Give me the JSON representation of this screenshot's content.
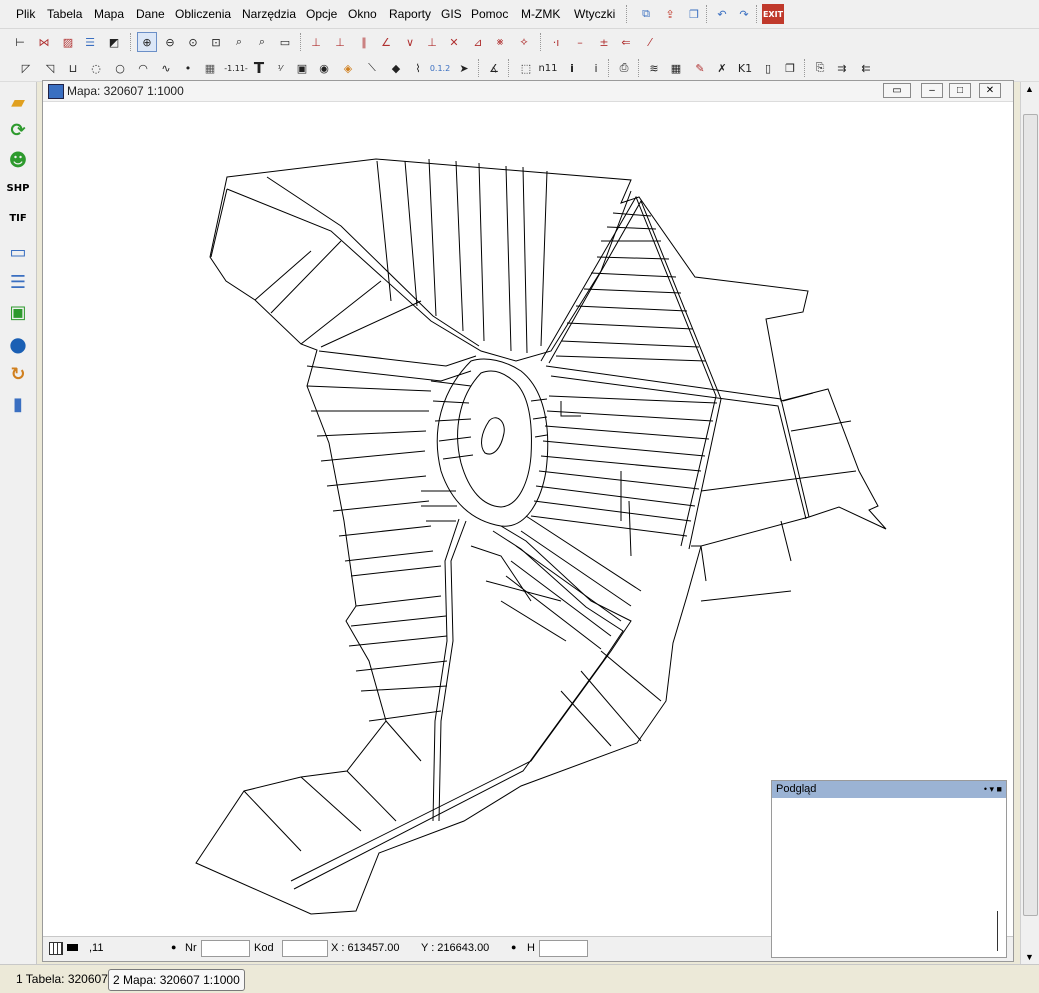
{
  "menu": [
    "Plik",
    "Tabela",
    "Mapa",
    "Dane",
    "Obliczenia",
    "Narzędzia",
    "Opcje",
    "Okno",
    "Raporty",
    "GIS",
    "Pomoc",
    "M-ZMK",
    "Wtyczki"
  ],
  "icons": {
    "open_folder": "open-folder-icon",
    "refresh": "refresh-icon",
    "user": "user-icon",
    "shp": "SHP",
    "tif": "TIF",
    "exit": "EXIT"
  },
  "map_window": {
    "title": "Mapa: 320607  1:1000"
  },
  "status": {
    "layer_value": ",11",
    "nr_label": "Nr",
    "nr_value": "",
    "kod_label": "Kod",
    "kod_value": "",
    "x_readout": "X : 613457.00",
    "y_readout": "Y : 216643.00",
    "h_label": "H",
    "h_value": ""
  },
  "preview": {
    "title": "Podgląd"
  },
  "taskbar": [
    {
      "label": "1 Tabela: 320607",
      "active": false
    },
    {
      "label": "2 Mapa: 320607  1:1000",
      "active": true
    }
  ],
  "toolbar": {
    "label_111": "-1.11-",
    "label_k1": "K1",
    "label_012": "0.1.2",
    "label_n11": "n11"
  }
}
